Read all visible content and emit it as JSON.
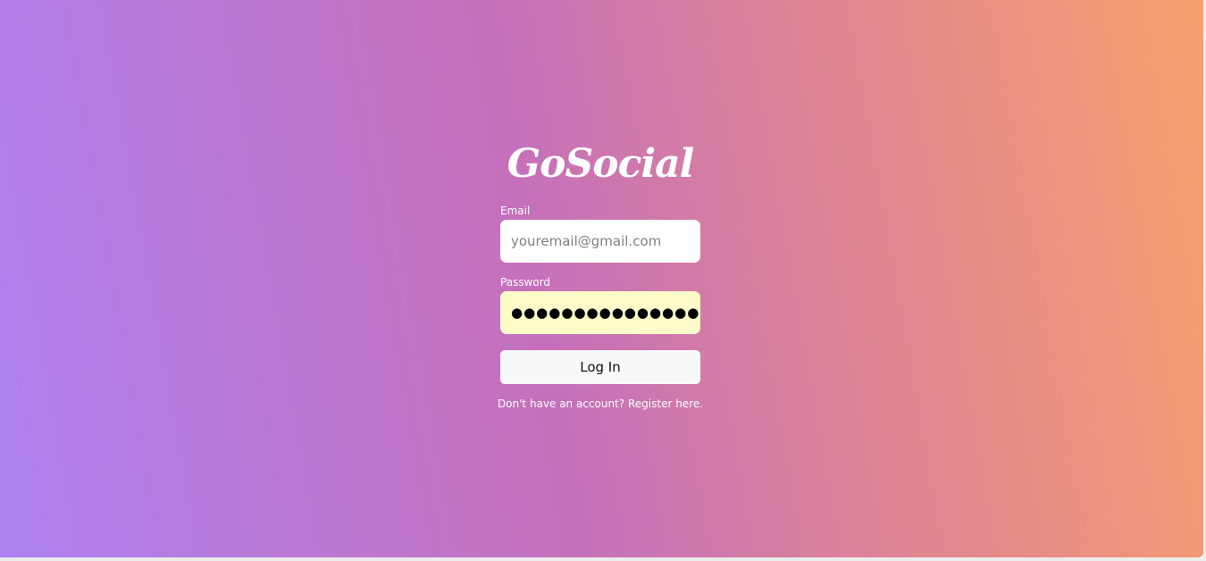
{
  "brand": {
    "logo_text": "GoSocial"
  },
  "login_form": {
    "email_label": "Email",
    "email_placeholder": "youremail@gmail.com",
    "email_value": "",
    "password_label": "Password",
    "password_value": "●●●●●●●●●●●●●●●",
    "submit_label": "Log In",
    "register_prompt": "Don't have an account?",
    "register_link": "Register here."
  },
  "colors": {
    "gradient_start": "#ad82f2",
    "gradient_mid": "#c670bb",
    "gradient_end": "#f8a06c",
    "password_autofill": "#fefbc8",
    "button_background": "#f7f8fa"
  }
}
